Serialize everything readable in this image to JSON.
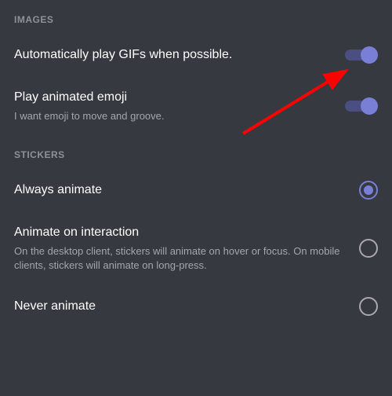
{
  "sections": {
    "images": {
      "header": "IMAGES",
      "items": [
        {
          "title": "Automatically play GIFs when possible.",
          "subtitle": null,
          "on": true
        },
        {
          "title": "Play animated emoji",
          "subtitle": "I want emoji to move and groove.",
          "on": true
        }
      ]
    },
    "stickers": {
      "header": "STICKERS",
      "options": [
        {
          "title": "Always animate",
          "subtitle": null,
          "selected": true
        },
        {
          "title": "Animate on interaction",
          "subtitle": "On the desktop client, stickers will animate on hover or focus. On mobile clients, stickers will animate on long-press.",
          "selected": false
        },
        {
          "title": "Never animate",
          "subtitle": null,
          "selected": false
        }
      ]
    }
  },
  "annotation": {
    "type": "arrow",
    "color": "#ff0000",
    "target": "auto-play-gifs-toggle"
  }
}
